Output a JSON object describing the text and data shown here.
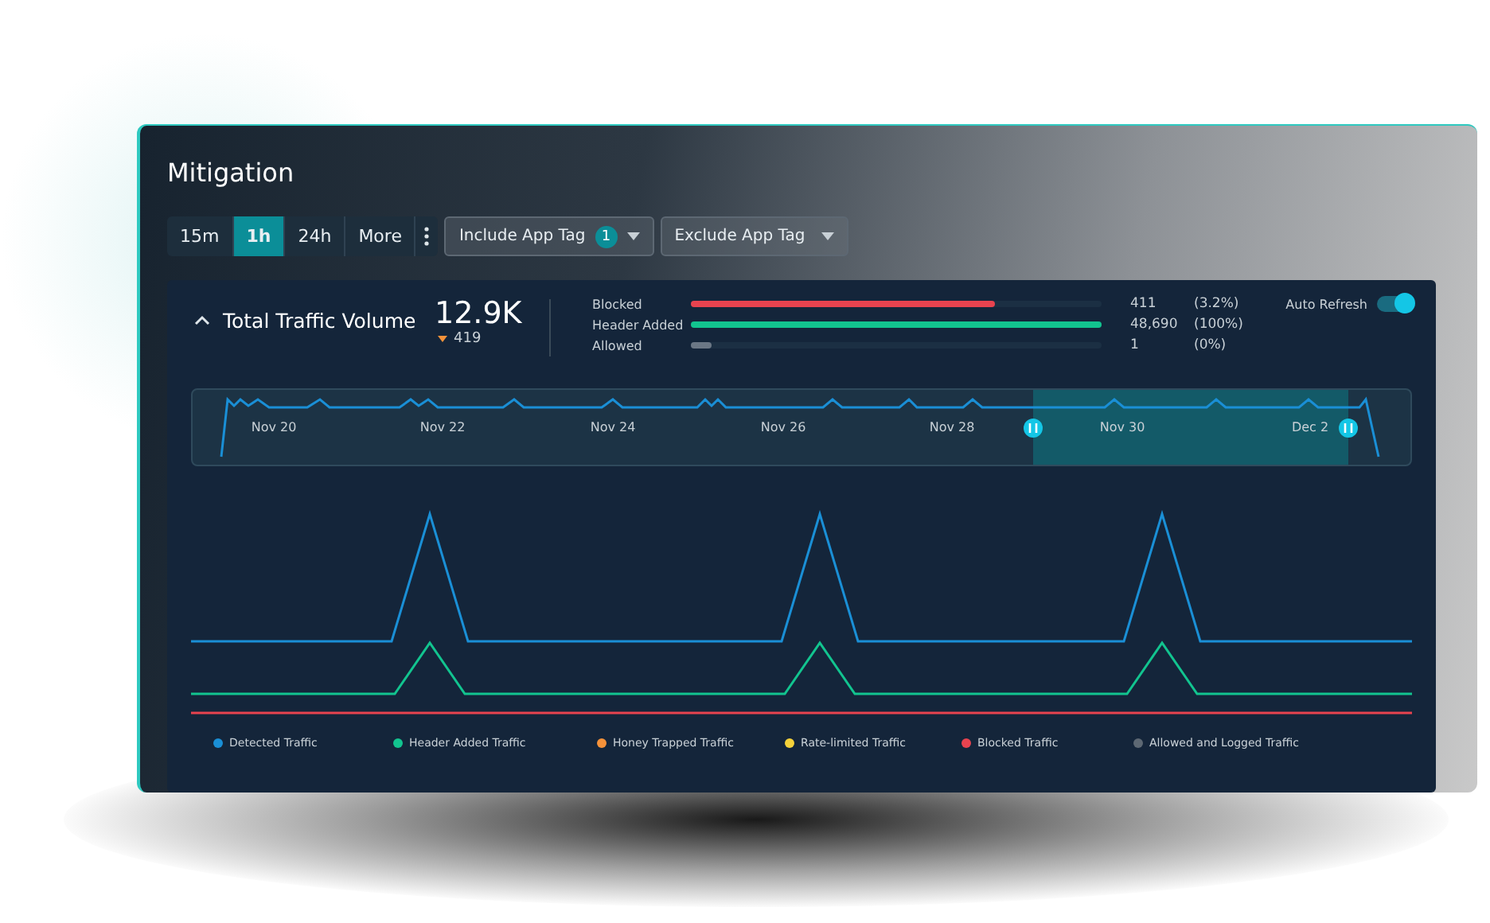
{
  "title": "Mitigation",
  "ranges": [
    {
      "label": "15m",
      "selected": false
    },
    {
      "label": "1h",
      "selected": true
    },
    {
      "label": "24h",
      "selected": false
    },
    {
      "label": "More",
      "selected": false
    }
  ],
  "filters": [
    {
      "label": "Include App Tag",
      "badge": "1"
    },
    {
      "label": "Exclude App Tag"
    }
  ],
  "summary": {
    "title": "Total Traffic Volume",
    "value": "12.9K",
    "delta": "419"
  },
  "metrics": [
    {
      "name": "Blocked",
      "level": 0.74,
      "color": "#e8434f",
      "count": "411",
      "share": "(3.2%)"
    },
    {
      "name": "Header Added",
      "level": 1,
      "color": "#12c48f",
      "count": "48,690",
      "share": "(100%)"
    },
    {
      "name": "Allowed",
      "level": 0.05,
      "color": "#6b7785",
      "count": "1",
      "share": "(0%)"
    }
  ],
  "auto_refresh": {
    "label": "Auto Refresh",
    "on": true
  },
  "timeline": {
    "labels": [
      "Nov 20",
      "Nov 22",
      "Nov 24",
      "Nov 26",
      "Nov 28",
      "Nov 30",
      "Dec 2"
    ]
  },
  "legend": [
    {
      "label": "Detected Traffic",
      "color": "#1a8fd6"
    },
    {
      "label": "Header Added Traffic",
      "color": "#12c48f"
    },
    {
      "label": "Honey Trapped Traffic",
      "color": "#f5923a"
    },
    {
      "label": "Rate-limited Traffic",
      "color": "#f5d23a"
    },
    {
      "label": "Blocked Traffic",
      "color": "#e8434f"
    },
    {
      "label": "Allowed and Logged Traffic",
      "color": "#5d6873"
    }
  ]
}
